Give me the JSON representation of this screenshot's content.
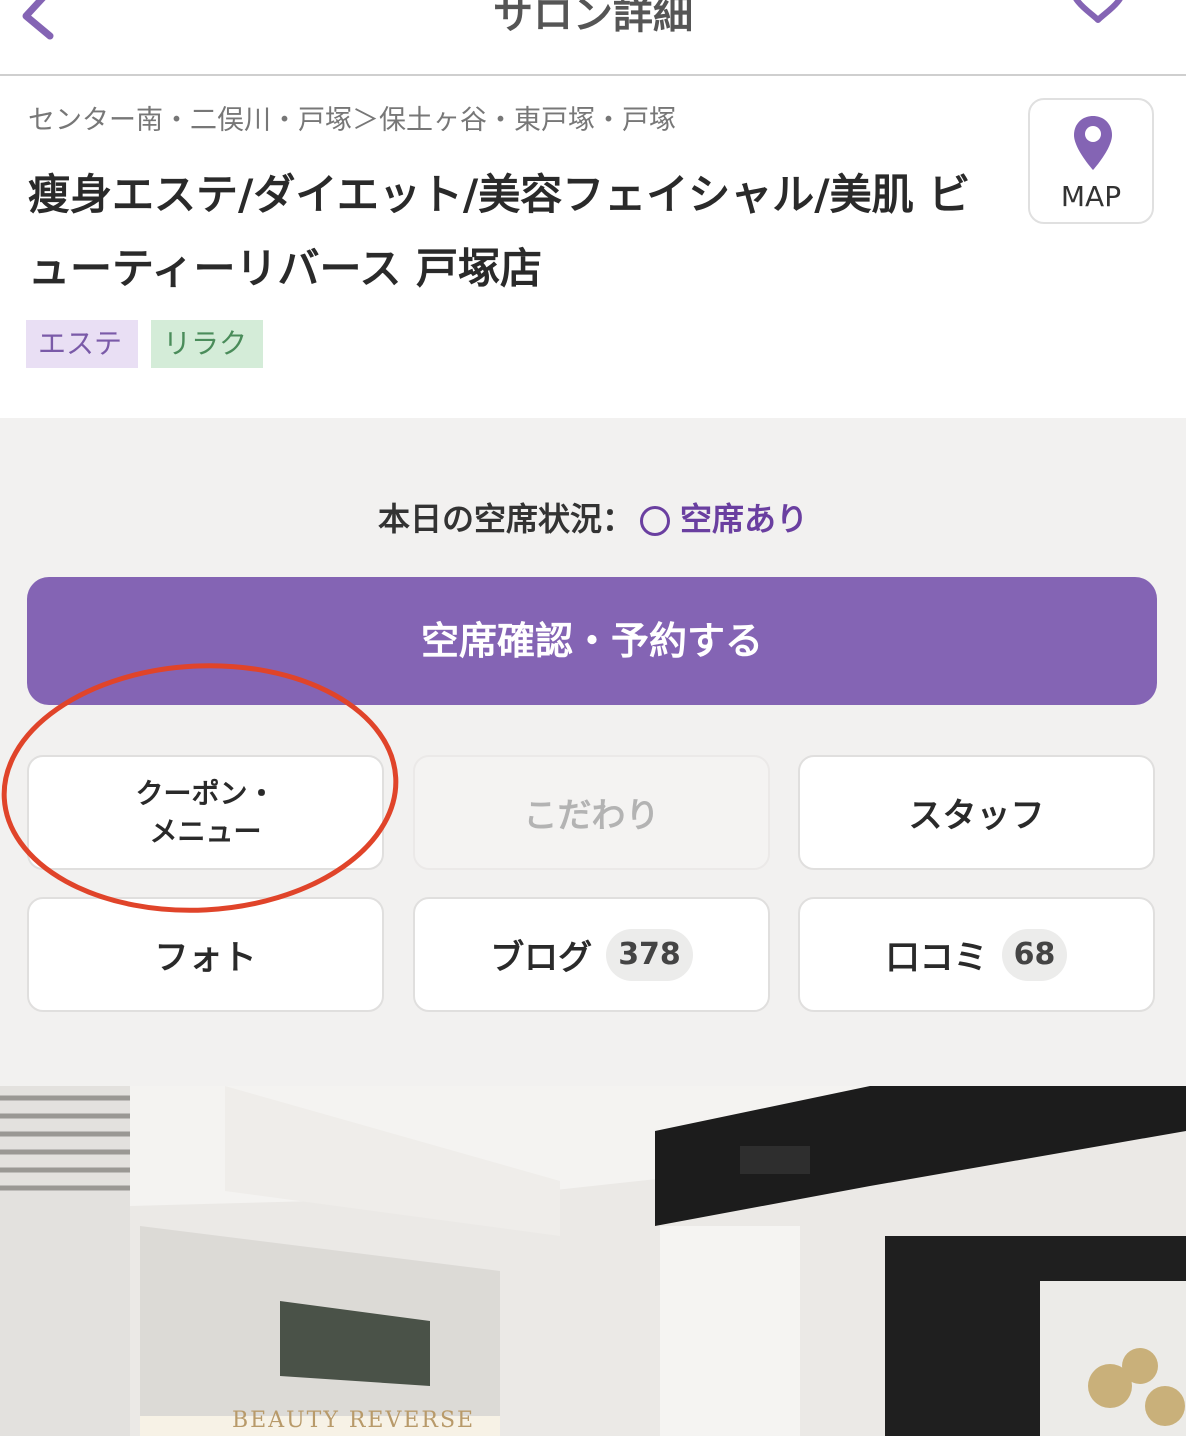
{
  "header": {
    "title": "サロン詳細"
  },
  "salon": {
    "breadcrumb": "センター南・二俣川・戸塚＞保土ヶ谷・東戸塚・戸塚",
    "name": "瘦身エステ/ダイエット/美容フェイシャル/美肌 ビューティーリバース 戸塚店",
    "map_label": "MAP",
    "tags": [
      "エステ",
      "リラク"
    ]
  },
  "availability": {
    "label": "本日の空席状況：",
    "status": "空席あり"
  },
  "reserve_button": "空席確認・予約する",
  "nav_buttons": {
    "coupon_line1": "クーポン・",
    "coupon_line2": "メニュー",
    "kodawari": "こだわり",
    "staff": "スタッフ",
    "photo": "フォト",
    "blog": "ブログ",
    "blog_count": "378",
    "review": "口コミ",
    "review_count": "68"
  },
  "photo": {
    "sign": "BEAUTY REVERSE"
  },
  "colors": {
    "accent": "#8464b4",
    "accent_text": "#6a3fa0",
    "annotation": "#e0442a",
    "tag_este_bg": "#e9dff4",
    "tag_relax_bg": "#d4ecd8"
  },
  "icons": [
    "back-chevron-icon",
    "heart-pin-icon",
    "map-pin-icon"
  ]
}
